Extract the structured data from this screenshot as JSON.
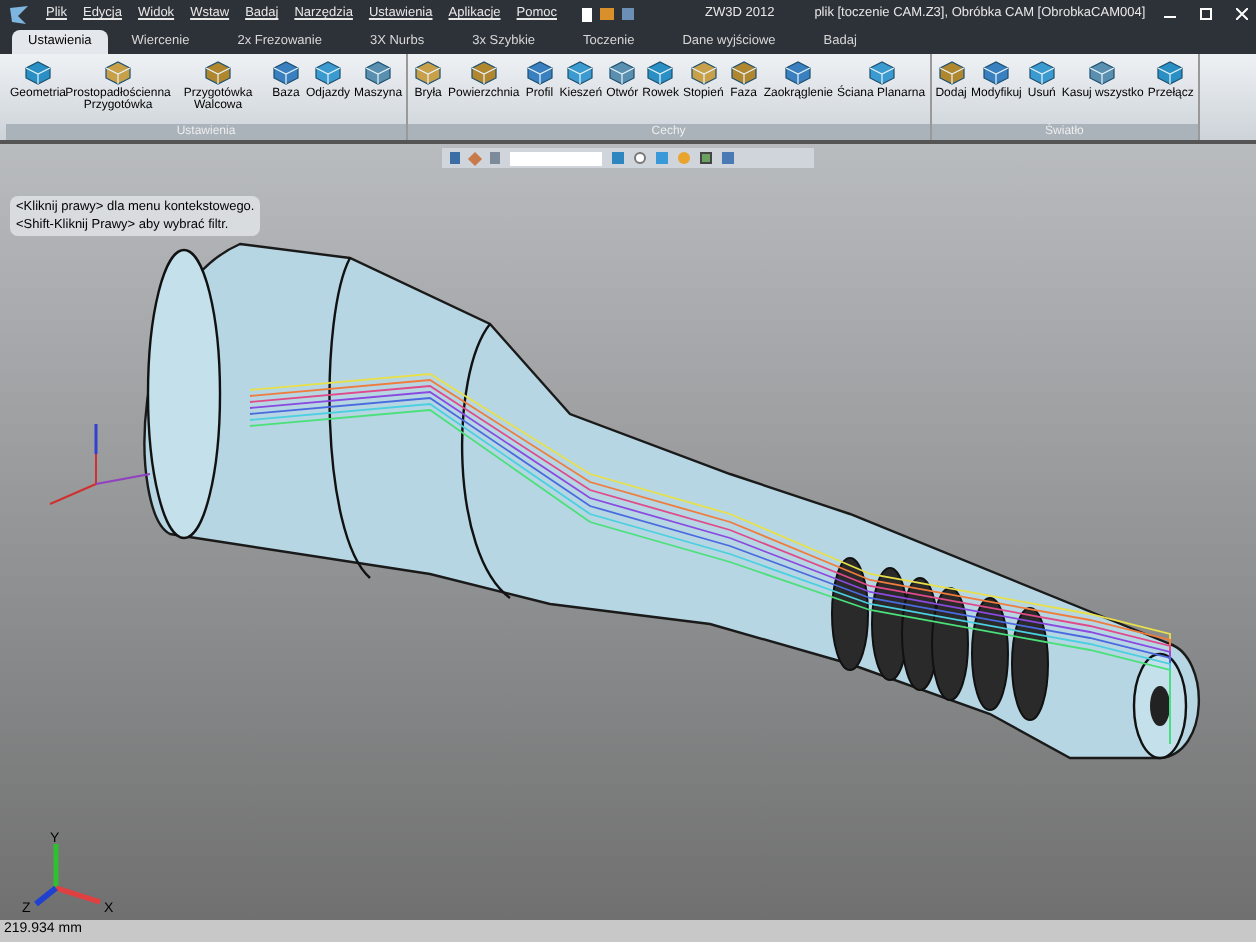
{
  "window": {
    "app": "ZW3D 2012",
    "title": "plik [toczenie CAM.Z3],  Obróbka CAM [ObrobkaCAM004]"
  },
  "menu": [
    "Plik",
    "Edycja",
    "Widok",
    "Wstaw",
    "Badaj",
    "Narzędzia",
    "Ustawienia",
    "Aplikacje",
    "Pomoc"
  ],
  "tabs": [
    {
      "label": "Ustawienia",
      "selected": true
    },
    {
      "label": "Wiercenie",
      "selected": false
    },
    {
      "label": "2x Frezowanie",
      "selected": false
    },
    {
      "label": "3X Nurbs",
      "selected": false
    },
    {
      "label": "3x Szybkie",
      "selected": false
    },
    {
      "label": "Toczenie",
      "selected": false
    },
    {
      "label": "Dane wyjściowe",
      "selected": false
    },
    {
      "label": "Badaj",
      "selected": false
    }
  ],
  "ribbon_groups": [
    {
      "title": "Ustawienia",
      "items": [
        "Geometria",
        "Prostopadłościenna Przygotówka",
        "Przygotówka Walcowa",
        "Baza",
        "Odjazdy",
        "Maszyna"
      ]
    },
    {
      "title": "Cechy",
      "items": [
        "Bryła",
        "Powierzchnia",
        "Profil",
        "Kieszeń",
        "Otwór",
        "Rowek",
        "Stopień",
        "Faza",
        "Zaokrąglenie",
        "Ściana Planarna"
      ]
    },
    {
      "title": "Światło",
      "items": [
        "Dodaj",
        "Modyfikuj",
        "Usuń",
        "Kasuj wszystko",
        "Przełącz"
      ]
    }
  ],
  "hint": [
    "<Kliknij prawy>  dla menu kontekstowego.",
    "<Shift-Kliknij Prawy>  aby wybrać filtr."
  ],
  "triad": {
    "x": "X",
    "y": "Y",
    "z": "Z"
  },
  "status_bar": {
    "scale": "219.934 mm"
  }
}
